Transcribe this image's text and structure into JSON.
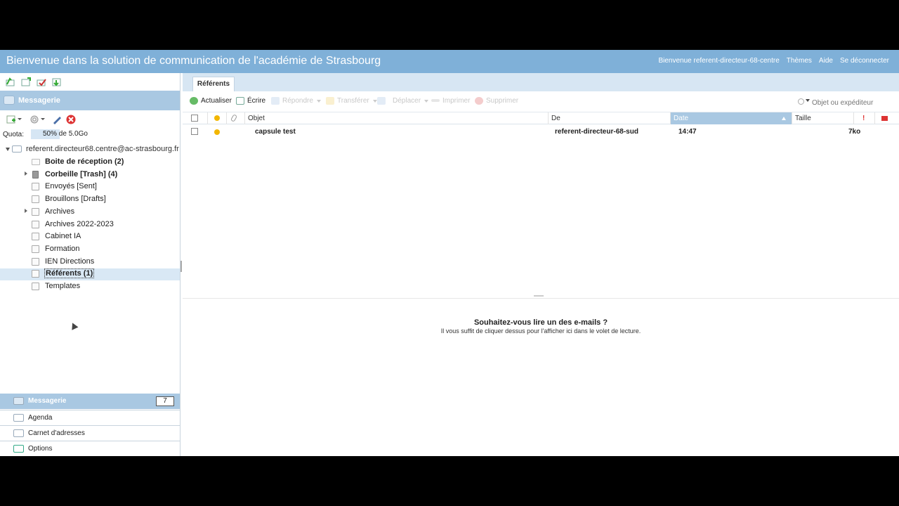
{
  "header": {
    "title": "Bienvenue dans la solution de communication de l'académie de Strasbourg",
    "welcome": "Bienvenue referent-directeur-68-centre",
    "themes": "Thèmes",
    "help": "Aide",
    "logout": "Se déconnecter"
  },
  "sidebar": {
    "section_title": "Messagerie",
    "quota_label": "Quota:",
    "quota_text": "50% de 5.0Go",
    "quota_percent": 50,
    "account": "referent.directeur68.centre@ac-strasbourg.fr",
    "folders": [
      {
        "label": "Boite de réception (2)",
        "icon": "inbox-icon",
        "bold": true
      },
      {
        "label": "Corbeille [Trash] (4)",
        "icon": "trash-icon",
        "bold": true,
        "expandable": true
      },
      {
        "label": "Envoyés [Sent]",
        "icon": "sent-icon"
      },
      {
        "label": "Brouillons [Drafts]",
        "icon": "folder-icon"
      },
      {
        "label": "Archives",
        "icon": "folder-icon",
        "expandable": true
      },
      {
        "label": "Archives 2022-2023",
        "icon": "folder-icon"
      },
      {
        "label": "Cabinet IA",
        "icon": "folder-icon"
      },
      {
        "label": "Formation",
        "icon": "folder-icon"
      },
      {
        "label": "IEN Directions",
        "icon": "folder-icon"
      },
      {
        "label": "Référents (1)",
        "icon": "folder-icon",
        "bold": true,
        "selected": true
      },
      {
        "label": "Templates",
        "icon": "folder-icon"
      }
    ]
  },
  "bottom_nav": {
    "messagerie": "Messagerie",
    "messagerie_count": "7",
    "agenda": "Agenda",
    "contacts": "Carnet d'adresses",
    "options": "Options"
  },
  "main": {
    "tab": "Référents",
    "toolbar": {
      "refresh": "Actualiser",
      "compose": "Écrire",
      "reply": "Répondre",
      "forward": "Transférer",
      "move": "Déplacer",
      "print": "Imprimer",
      "delete": "Supprimer"
    },
    "search_placeholder": "Objet ou expéditeur",
    "columns": {
      "subject": "Objet",
      "from": "De",
      "date": "Date",
      "size": "Taille"
    },
    "messages": [
      {
        "subject": "capsule test",
        "from": "referent-directeur-68-sud",
        "date": "14:47",
        "size": "7ko"
      }
    ],
    "preview": {
      "heading": "Souhaitez-vous lire un des e-mails ?",
      "subtext": "Il vous suffit de cliquer dessus pour l'afficher ici dans le volet de lecture."
    }
  },
  "colors": {
    "header_bg": "#7fb0d8",
    "accent": "#a9c8e2",
    "unread_dot": "#f2b600"
  }
}
